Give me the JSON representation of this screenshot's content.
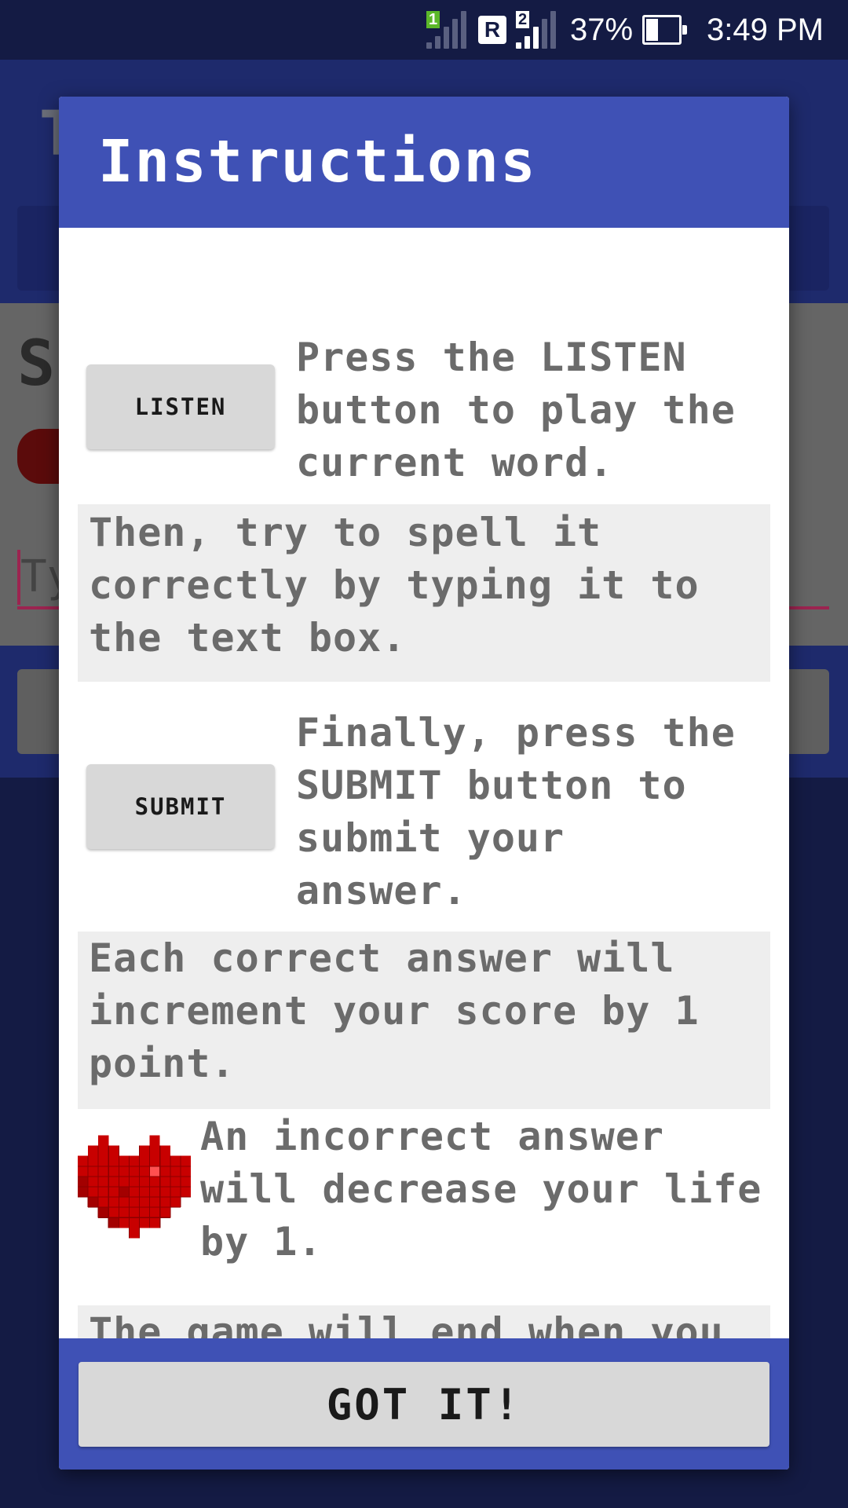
{
  "status_bar": {
    "sim1_label": "1",
    "roaming_label": "R",
    "sim2_label": "2",
    "battery_percent": "37%",
    "battery_level": 0.37,
    "time": "3:49 PM"
  },
  "background": {
    "title_fragment": "T",
    "score_fragment": "S",
    "input_fragment": "Ty"
  },
  "dialog": {
    "title": "Instructions",
    "listen_button_label": "LISTEN",
    "listen_text": "Press the LISTEN\nbutton to play the\ncurrent word.",
    "spell_text": "Then, try to spell it\ncorrectly by typing it to\nthe text box.",
    "submit_button_label": "SUBMIT",
    "submit_text": "Finally, press the\nSUBMIT button to\nsubmit your\nanswer.",
    "score_text": "Each correct answer will\nincrement your score by 1\npoint.",
    "life_text": "An incorrect answer\nwill decrease your life\nby 1.",
    "end_text": "The game will end when you\nran out of lives.",
    "got_it_label": "GOT IT!"
  },
  "colors": {
    "primary": "#3f51b5",
    "status_bar": "#141b44",
    "heart": "#cc0000"
  },
  "icons": {
    "heart": "pixel-heart-icon"
  }
}
